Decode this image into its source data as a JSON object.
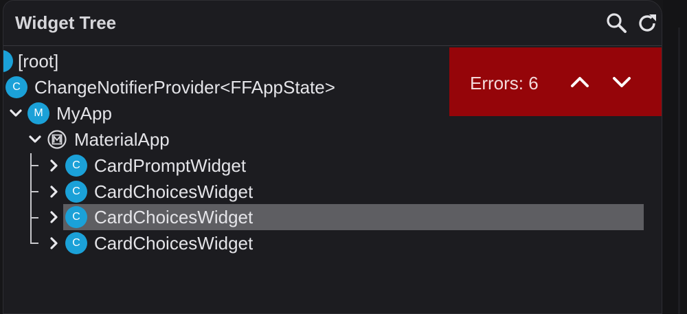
{
  "panel": {
    "title": "Widget Tree",
    "search_icon": "search-icon",
    "refresh_icon": "refresh-icon"
  },
  "tree": {
    "root_label": "[root]",
    "nodes": [
      {
        "label": "ChangeNotifierProvider<FFAppState>",
        "badge": "C"
      },
      {
        "label": "MyApp",
        "badge": "M",
        "expanded": true
      },
      {
        "label": "MaterialApp",
        "badge": "M",
        "expanded": true
      },
      {
        "label": "CardPromptWidget",
        "badge": "C",
        "expanded": false
      },
      {
        "label": "CardChoicesWidget",
        "badge": "C",
        "expanded": false
      },
      {
        "label": "CardChoicesWidget",
        "badge": "C",
        "expanded": false,
        "selected": true
      },
      {
        "label": "CardChoicesWidget",
        "badge": "C",
        "expanded": false
      }
    ]
  },
  "errors": {
    "label": "Errors: 6",
    "prev_icon": "chevron-up-icon",
    "next_icon": "chevron-down-icon"
  },
  "colors": {
    "badge": "#1ba1d8",
    "error_bg": "#950509",
    "selection": "#5e5e62",
    "panel_bg": "#1c1c20"
  }
}
